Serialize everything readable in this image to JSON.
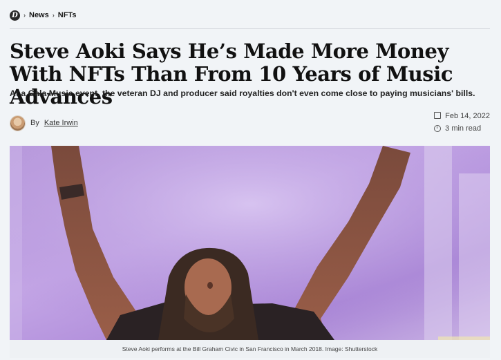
{
  "breadcrumb": {
    "logo_glyph": "D",
    "items": [
      "News",
      "NFTs"
    ],
    "separator": "›"
  },
  "article": {
    "title": "Steve Aoki Says He’s Made More Money With NFTs Than From 10 Years of Music Advances",
    "subtitle": "At a Gala Music event, the veteran DJ and producer said royalties don't even come close to paying musicians' bills.",
    "byline_prefix": "By",
    "author": "Kate Irwin",
    "date": "Feb 14, 2022",
    "read_time": "3 min read"
  },
  "image": {
    "caption": "Steve Aoki performs at the Bill Graham Civic in San Francisco in March 2018. Image: Shutterstock"
  }
}
